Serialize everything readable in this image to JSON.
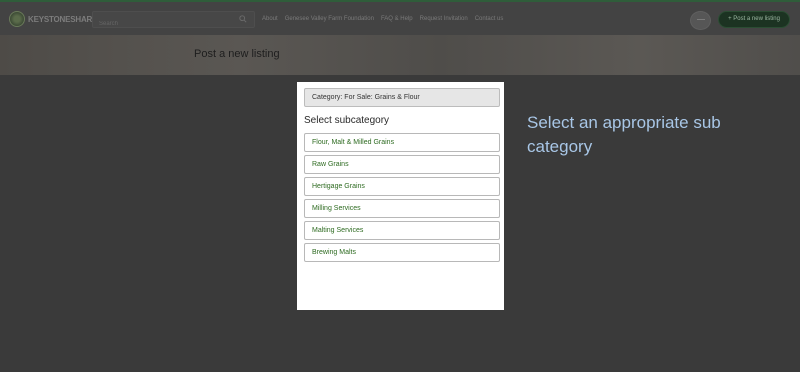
{
  "header": {
    "logo_text": "KEYSTONESHARE",
    "search_placeholder": "Search",
    "nav": [
      "About",
      "Genesee Valley Farm Foundation",
      "FAQ & Help",
      "Request Invitation",
      "Contact us"
    ],
    "post_button_label": "+ Post a new listing"
  },
  "hero": {
    "title": "Post a new listing"
  },
  "card": {
    "category_label": "Category: For Sale: Grains & Flour",
    "subcategory_heading": "Select subcategory",
    "options": [
      "Flour, Malt & Milled Grains",
      "Raw Grains",
      "Hertigage Grains",
      "Milling Services",
      "Malting Services",
      "Brewing Malts"
    ]
  },
  "instruction": "Select an appropriate sub category"
}
